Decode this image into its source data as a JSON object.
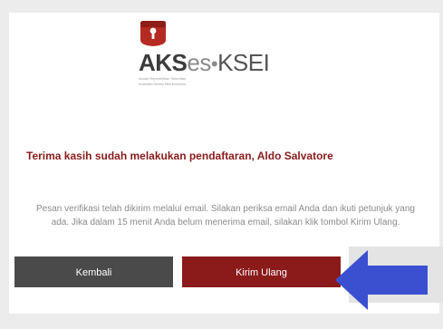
{
  "logo": {
    "wordmark_aks": "AKS",
    "wordmark_es": "es",
    "wordmark_sep": "•",
    "wordmark_ksei": "KSEI",
    "tagline": "Acuan Kepemilikan Sekuritas",
    "subtitle": "Kustodian Sentral Efek Indonesia"
  },
  "thanks_message": "Terima kasih sudah melakukan pendaftaran, Aldo Salvatore",
  "verification_message": "Pesan verifikasi telah dikirim melalui email. Silakan periksa email Anda dan ikuti petunjuk yang ada. Jika dalam 15 menit Anda belum menerima email, silakan klik tombol Kirim Ulang.",
  "buttons": {
    "back_label": "Kembali",
    "resend_label": "Kirim Ulang"
  },
  "colors": {
    "brand_red": "#8b1a1a",
    "back_button": "#4a4a4a",
    "annotation_arrow": "#3b4fd1"
  },
  "icons": {
    "logo": "keyhole-shield-icon",
    "annotation": "arrow-left-icon"
  }
}
